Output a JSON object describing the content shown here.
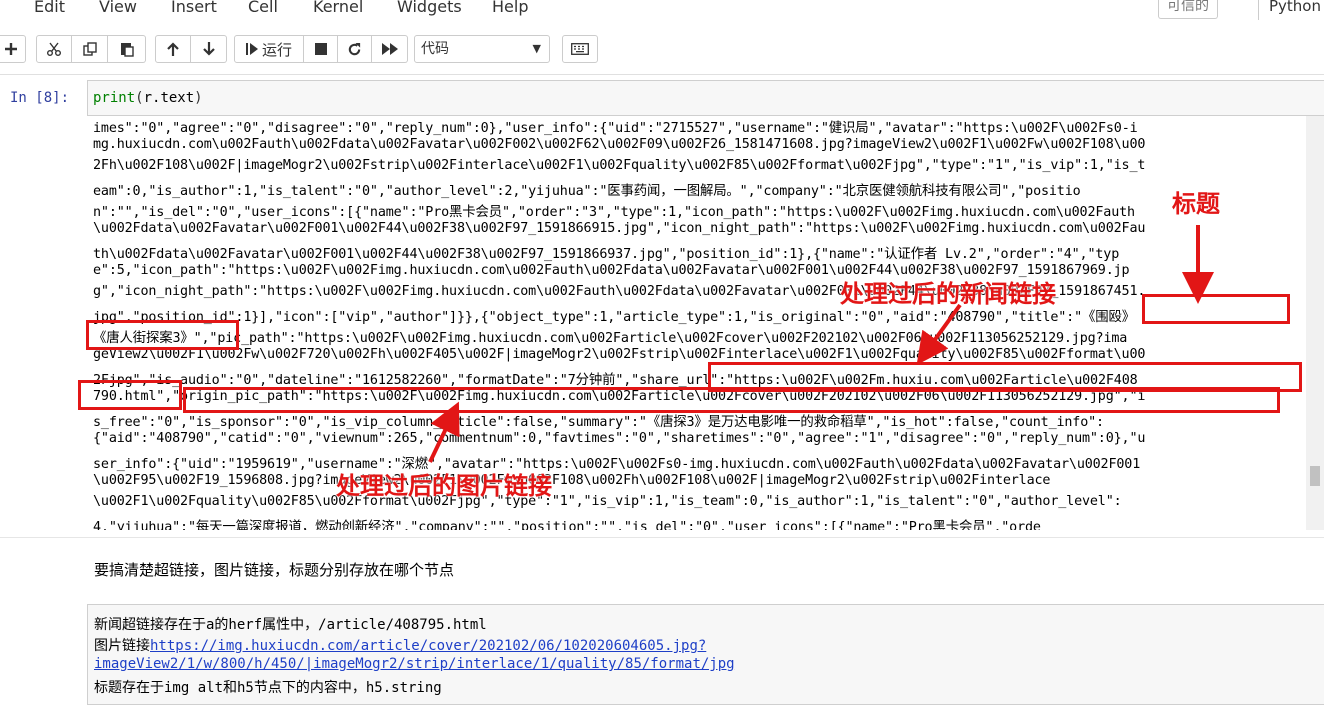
{
  "menu": {
    "items": [
      "Edit",
      "View",
      "Insert",
      "Cell",
      "Kernel",
      "Widgets",
      "Help"
    ],
    "trusted": "可信的",
    "kernel": "Python"
  },
  "toolbar": {
    "run_label": "运行",
    "cell_type": "代码"
  },
  "input_cell": {
    "prompt": "In  [8]:",
    "code_func": "print",
    "code_open": "(",
    "code_arg": "r.text",
    "code_close": ")"
  },
  "output_lines": [
    "imes\":\"0\",\"agree\":\"0\",\"disagree\":\"0\",\"reply_num\":0},\"user_info\":{\"uid\":\"2715527\",\"username\":\"健识局\",\"avatar\":\"https:\\u002F\\u002Fs0-i",
    "mg.huxiucdn.com\\u002Fauth\\u002Fdata\\u002Favatar\\u002F002\\u002F62\\u002F09\\u002F26_1581471608.jpg?imageView2\\u002F1\\u002Fw\\u002F108\\u00",
    "2Fh\\u002F108\\u002F|imageMogr2\\u002Fstrip\\u002Finterlace\\u002F1\\u002Fquality\\u002F85\\u002Fformat\\u002Fjpg\",\"type\":\"1\",\"is_vip\":1,\"is_t",
    "eam\":0,\"is_author\":1,\"is_talent\":\"0\",\"author_level\":2,\"yijuhua\":\"医事药闻，一图解局。\",\"company\":\"北京医健领航科技有限公司\",\"positio",
    "n\":\"\",\"is_del\":\"0\",\"user_icons\":[{\"name\":\"Pro黑卡会员\",\"order\":\"3\",\"type\":1,\"icon_path\":\"https:\\u002F\\u002Fimg.huxiucdn.com\\u002Fauth",
    "\\u002Fdata\\u002Favatar\\u002F001\\u002F44\\u002F38\\u002F97_1591866915.jpg\",\"icon_night_path\":\"https:\\u002F\\u002Fimg.huxiucdn.com\\u002Fau",
    "th\\u002Fdata\\u002Favatar\\u002F001\\u002F44\\u002F38\\u002F97_1591866937.jpg\",\"position_id\":1},{\"name\":\"认证作者 Lv.2\",\"order\":\"4\",\"typ",
    "e\":5,\"icon_path\":\"https:\\u002F\\u002Fimg.huxiucdn.com\\u002Fauth\\u002Fdata\\u002Favatar\\u002F001\\u002F44\\u002F38\\u002F97_1591867969.jp",
    "g\",\"icon_night_path\":\"https:\\u002F\\u002Fimg.huxiucdn.com\\u002Fauth\\u002Fdata\\u002Favatar\\u002F001\\u002F44\\u002F38\\u002F97_1591867451.",
    "jpg\",\"position_id\":1}],\"icon\":[\"vip\",\"author\"]}},{\"object_type\":1,\"article_type\":1,\"is_original\":\"0\",\"aid\":\"408790\",\"title\":\"《围殴》",
    "《唐人街探案3》\",\"pic_path\":\"https:\\u002F\\u002Fimg.huxiucdn.com\\u002Farticle\\u002Fcover\\u002F202102\\u002F06\\u002F113056252129.jpg?ima",
    "geView2\\u002F1\\u002Fw\\u002F720\\u002Fh\\u002F405\\u002F|imageMogr2\\u002Fstrip\\u002Finterlace\\u002F1\\u002Fquality\\u002F85\\u002Fformat\\u00",
    "2Fjpg\",\"is_audio\":\"0\",\"dateline\":\"1612582260\",\"formatDate\":\"7分钟前\",\"share_url\":\"https:\\u002F\\u002Fm.huxiu.com\\u002Farticle\\u002F408",
    "790.html\",\"origin_pic_path\":\"https:\\u002F\\u002Fimg.huxiucdn.com\\u002Farticle\\u002Fcover\\u002F202102\\u002F06\\u002F113056252129.jpg\",\"i",
    "s_free\":\"0\",\"is_sponsor\":\"0\",\"is_vip_column_article\":false,\"summary\":\"《唐探3》是万达电影唯一的救命稻草\",\"is_hot\":false,\"count_info\":",
    "{\"aid\":\"408790\",\"catid\":\"0\",\"viewnum\":265,\"commentnum\":0,\"favtimes\":\"0\",\"sharetimes\":\"0\",\"agree\":\"1\",\"disagree\":\"0\",\"reply_num\":0},\"u",
    "ser_info\":{\"uid\":\"1959619\",\"username\":\"深燃\",\"avatar\":\"https:\\u002F\\u002Fs0-img.huxiucdn.com\\u002Fauth\\u002Fdata\\u002Favatar\\u002F001",
    "\\u002F95\\u002F19_1596808.jpg?imageView2\\u002F1\\u002Fw\\u002F108\\u002Fh\\u002F108\\u002F|imageMogr2\\u002Fstrip\\u002Finterlace",
    "\\u002F1\\u002Fquality\\u002F85\\u002Fformat\\u002Fjpg\",\"type\":\"1\",\"is_vip\":1,\"is_team\":0,\"is_author\":1,\"is_talent\":\"0\",\"author_level\":",
    "4,\"yijuhua\":\"每天一篇深度报道，燃动创新经济\",\"company\":\"\",\"position\":\"\",\"is_del\":\"0\",\"user_icons\":[{\"name\":\"Pro黑卡会员\",\"orde"
  ],
  "annotations": {
    "title_label": "标题",
    "news_link_label": "处理过后的新闻链接",
    "image_link_label": "处理过后的图片链接"
  },
  "markdown": {
    "heading": "要搞清楚超链接，图片链接，标题分别存放在哪个节点",
    "line1": "新闻超链接存在于a的herf属性中，/article/408795.html",
    "line2_prefix": "图片链接",
    "line2_link": "https://img.huxiucdn.com/article/cover/202102/06/102020604605.jpg?",
    "line3_link": "imageView2/1/w/800/h/450/|imageMogr2/strip/interlace/1/quality/85/format/jpg",
    "line4": "标题存在于img alt和h5节点下的内容中，h5.string"
  }
}
